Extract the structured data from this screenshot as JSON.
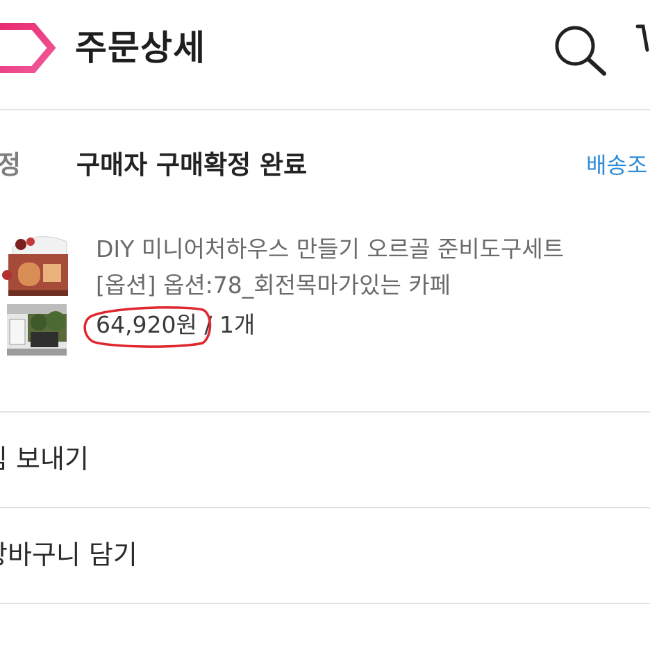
{
  "header": {
    "title": "주문상세",
    "back_icon": "chevron-left-icon",
    "search_icon": "search-icon",
    "cart_icon": "cart-icon",
    "brand_colors": [
      "#e8286f",
      "#f05a9a"
    ]
  },
  "order": {
    "status_label": "확정",
    "status_text": "구매자 구매확정 완료",
    "tracking_link": "배송조",
    "accent_color": "#2e8bd8"
  },
  "product": {
    "name": "DIY 미니어처하우스 만들기 오르골 준비도구세트",
    "option": "[옵션] 옵션:78_회전목마가있는 카페",
    "price": "64,920원",
    "separator": " / ",
    "quantity": "1개",
    "highlight_color": "#e0262f"
  },
  "actions": [
    {
      "label": "림 보내기"
    },
    {
      "label": "장바구니 담기"
    }
  ]
}
